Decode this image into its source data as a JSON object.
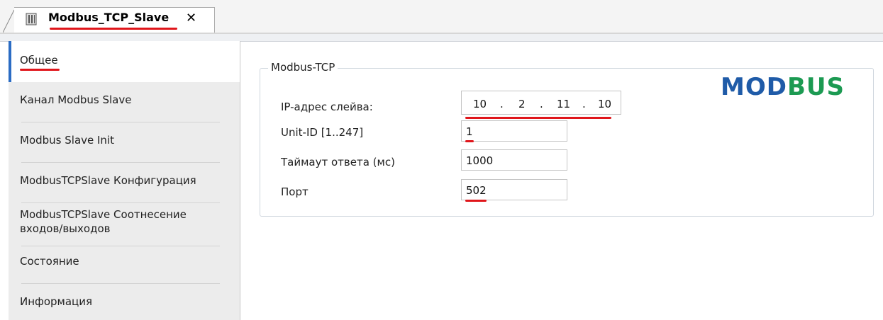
{
  "tab": {
    "title": "Modbus_TCP_Slave",
    "close": "✕"
  },
  "sidebar": {
    "items": [
      {
        "label": "Общее"
      },
      {
        "label": "Канал Modbus Slave"
      },
      {
        "label": "Modbus Slave Init"
      },
      {
        "label": "ModbusTCPSlave Конфигурация"
      },
      {
        "label": "ModbusTCPSlave Соотнесение входов/выходов"
      },
      {
        "label": "Состояние"
      },
      {
        "label": "Информация"
      }
    ]
  },
  "group": {
    "legend": "Modbus-TCP",
    "ip_label": "IP-адрес слейва:",
    "ip": [
      "10",
      "2",
      "11",
      "10"
    ],
    "ip_dot": ".",
    "unit_label": "Unit-ID [1..247]",
    "unit_value": "1",
    "timeout_label": "Таймаут ответа (мс)",
    "timeout_value": "1000",
    "port_label": "Порт",
    "port_value": "502"
  },
  "logo": {
    "part1": "MOD",
    "part2": "BUS"
  },
  "colors": {
    "accent": "#2b6cc4",
    "annotation": "#e0161b",
    "logo_blue": "#1f5ba8",
    "logo_green": "#1c9a52"
  }
}
